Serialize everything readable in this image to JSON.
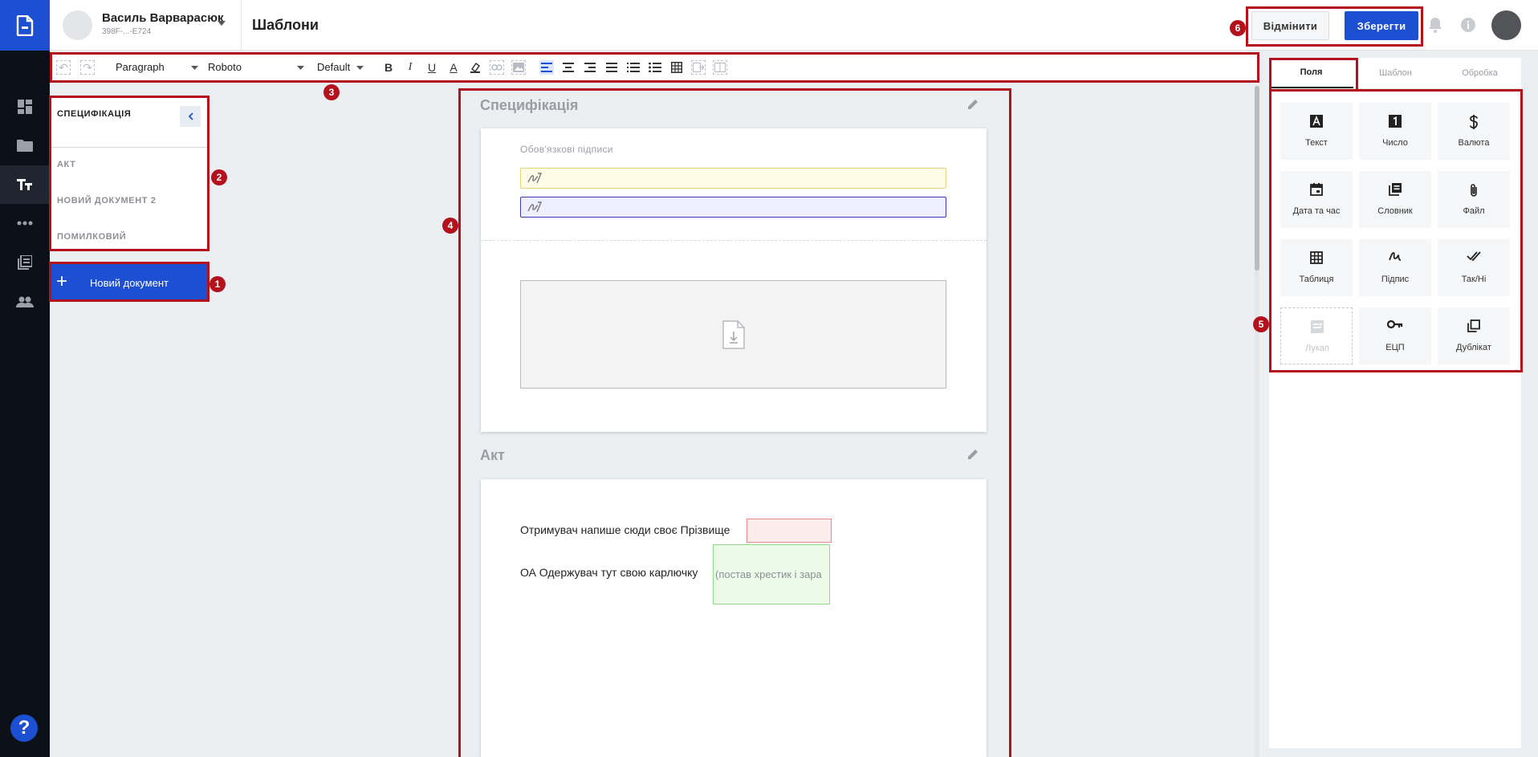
{
  "header": {
    "user_name": "Василь Варварасюк",
    "user_id": "398F-...-E724",
    "page_title": "Шаблони",
    "cancel_label": "Відмінити",
    "save_label": "Зберегти"
  },
  "toolbar": {
    "block_format": "Paragraph",
    "font_family": "Roboto",
    "font_size": "Default"
  },
  "doc_list": {
    "title": "СПЕЦИФІКАЦІЯ",
    "items": [
      "АКТ",
      "НОВИЙ ДОКУМЕНТ 2",
      "ПОМИЛКОВИЙ"
    ],
    "new_doc_label": "Новий документ"
  },
  "canvas": {
    "section1_title": "Специфікація",
    "required_signatures_label": "Обов'язкові підписи",
    "section2_title": "Акт",
    "line1": "Отримувач напише сюди своє Прізвище",
    "line2": "ОА Одержувач тут свою карлючку",
    "green_field_text": "(постав хрестик і зара"
  },
  "right_panel": {
    "tabs": [
      "Поля",
      "Шаблон",
      "Обробка"
    ],
    "fields": [
      {
        "label": "Текст",
        "icon": "text-icon"
      },
      {
        "label": "Число",
        "icon": "number-icon"
      },
      {
        "label": "Валюта",
        "icon": "dollar-icon"
      },
      {
        "label": "Дата та час",
        "icon": "calendar-icon"
      },
      {
        "label": "Словник",
        "icon": "dictionary-icon"
      },
      {
        "label": "Файл",
        "icon": "paperclip-icon"
      },
      {
        "label": "Таблиця",
        "icon": "table-icon"
      },
      {
        "label": "Підпис",
        "icon": "signature-icon"
      },
      {
        "label": "Так/Ні",
        "icon": "double-check-icon"
      },
      {
        "label": "Лукап",
        "icon": "lookup-icon"
      },
      {
        "label": "ЕЦП",
        "icon": "key-icon"
      },
      {
        "label": "Дублікат",
        "icon": "duplicate-icon"
      }
    ]
  },
  "annotations": [
    "1",
    "2",
    "3",
    "4",
    "5",
    "6"
  ],
  "colors": {
    "brand": "#1c4fd1",
    "rail": "#0c1119",
    "annotation": "#b3111b"
  }
}
